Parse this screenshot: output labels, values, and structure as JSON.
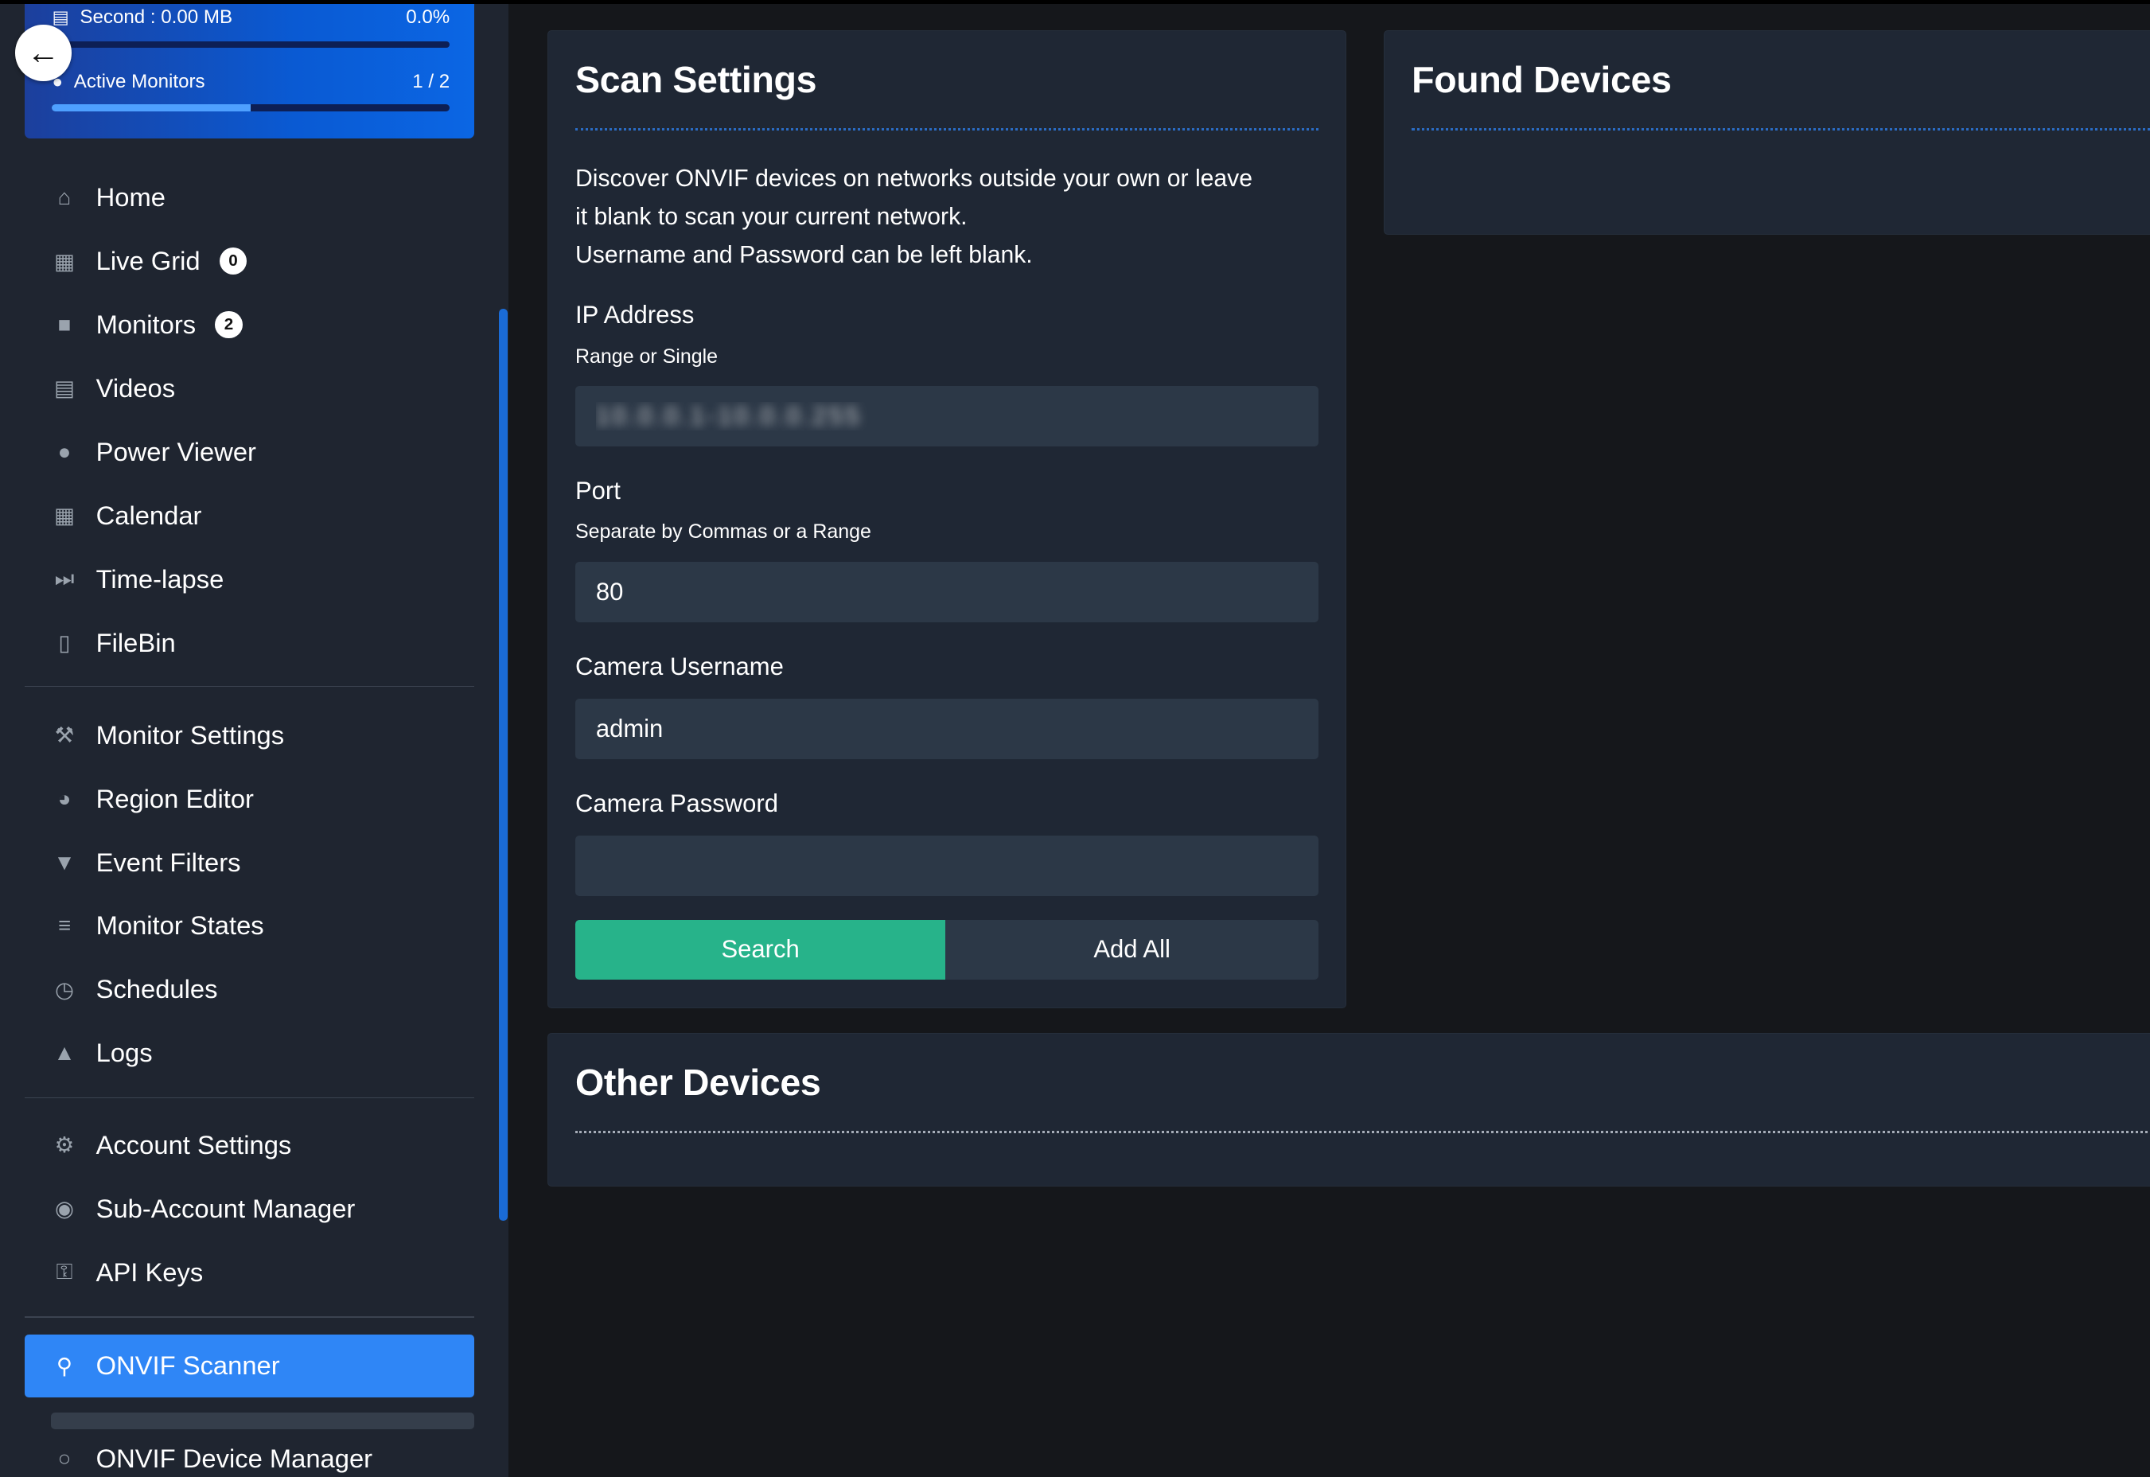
{
  "stats": {
    "storage_label": "Second : 0.00 MB",
    "storage_value": "0.0%",
    "storage_fraction": 0.0,
    "monitors_label": "Active Monitors",
    "monitors_value": "1 / 2",
    "monitors_fraction": 0.5
  },
  "nav": {
    "primary": [
      {
        "label": "Home",
        "icon": "home-icon"
      },
      {
        "label": "Live Grid",
        "icon": "grid-icon",
        "badge": "0"
      },
      {
        "label": "Monitors",
        "icon": "video-camera-icon",
        "badge": "2"
      },
      {
        "label": "Videos",
        "icon": "film-icon"
      },
      {
        "label": "Power Viewer",
        "icon": "map-pin-icon"
      },
      {
        "label": "Calendar",
        "icon": "calendar-icon"
      },
      {
        "label": "Time-lapse",
        "icon": "fast-forward-icon"
      },
      {
        "label": "FileBin",
        "icon": "file-icon"
      }
    ],
    "settings": [
      {
        "label": "Monitor Settings",
        "icon": "wrench-icon"
      },
      {
        "label": "Region Editor",
        "icon": "compass-icon"
      },
      {
        "label": "Event Filters",
        "icon": "filter-icon"
      },
      {
        "label": "Monitor States",
        "icon": "list-icon"
      },
      {
        "label": "Schedules",
        "icon": "clock-icon"
      },
      {
        "label": "Logs",
        "icon": "warning-icon"
      }
    ],
    "account": [
      {
        "label": "Account Settings",
        "icon": "gears-icon"
      },
      {
        "label": "Sub-Account Manager",
        "icon": "users-icon"
      },
      {
        "label": "API Keys",
        "icon": "key-icon"
      }
    ],
    "tools": [
      {
        "label": "ONVIF Scanner",
        "icon": "search-icon",
        "active": true
      },
      {
        "label": "ONVIF Device Manager",
        "icon": "circle-icon"
      }
    ]
  },
  "scan": {
    "title": "Scan Settings",
    "description": [
      "Discover ONVIF devices on networks outside your own or leave",
      "it blank to scan your current network.",
      "Username and Password can be left blank."
    ],
    "ip_label": "IP Address",
    "ip_hint": "Range or Single",
    "ip_value": "10.0.0.1-10.0.0.255",
    "port_label": "Port",
    "port_hint": "Separate by Commas or a Range",
    "port_value": "80",
    "username_label": "Camera Username",
    "username_value": "admin",
    "password_label": "Camera Password",
    "password_value": "",
    "search_label": "Search",
    "add_all_label": "Add All"
  },
  "found": {
    "title": "Found Devices"
  },
  "other": {
    "title": "Other Devices"
  },
  "colors": {
    "accent": "#2f86f6",
    "search_button": "#27b38a",
    "panel_bg": "#1f2734",
    "page_bg": "#15171b"
  }
}
